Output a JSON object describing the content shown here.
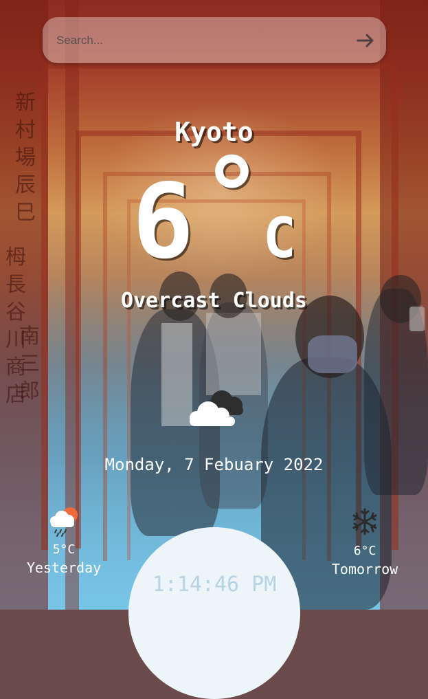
{
  "search": {
    "placeholder": "Search...",
    "button_icon": "arrow-right-icon"
  },
  "weather": {
    "city": "Kyoto",
    "temperature": "6",
    "degree": "°",
    "unit": "C",
    "description": "Overcast Clouds",
    "icon": "overcast-clouds-icon",
    "date": "Monday, 7 Febuary 2022"
  },
  "yesterday": {
    "temp": "5°C",
    "label": "Yesterday",
    "icon": "rain-sun-cloud-icon"
  },
  "tomorrow": {
    "temp": "6°C",
    "label": "Tomorrow",
    "icon": "snowflake-icon"
  },
  "clock": {
    "time": "1:14:46 PM"
  },
  "colors": {
    "text": "#ffffff",
    "clock_text": "#b7d3e2",
    "clock_dome": "#eef5f9",
    "snowflake": "#2b2b2b",
    "sun": "#ef6b3a"
  }
}
